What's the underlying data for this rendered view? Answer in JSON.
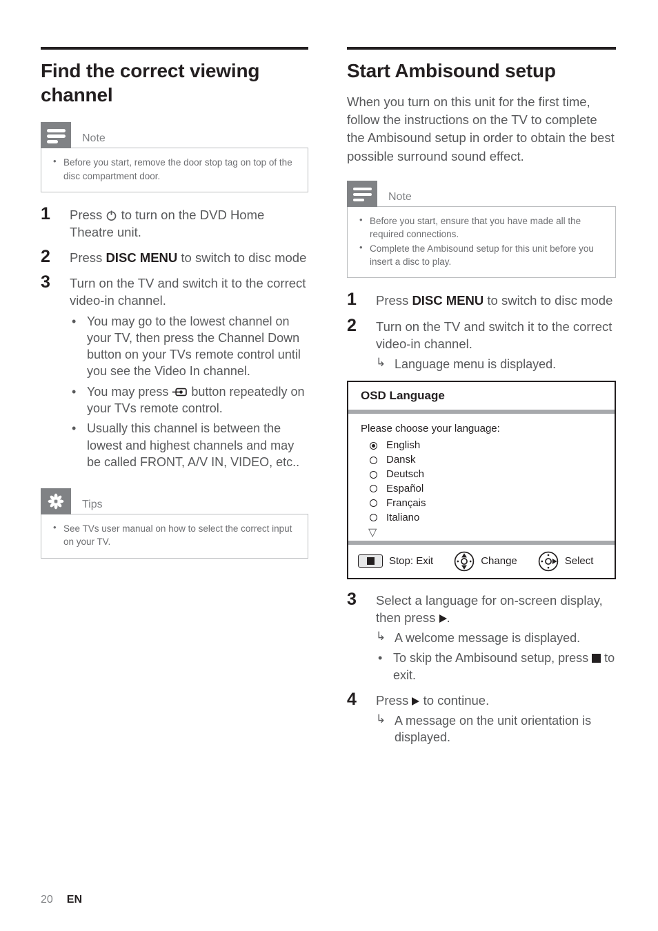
{
  "left": {
    "heading": "Find the correct viewing channel",
    "note": {
      "title": "Note",
      "icon": "note-lines-icon",
      "items": [
        "Before you start, remove the door stop tag on top of the disc compartment door."
      ]
    },
    "steps": [
      {
        "num": "1",
        "pre": "Press ",
        "icon": "power-icon",
        "post": " to turn on the DVD Home Theatre unit."
      },
      {
        "num": "2",
        "pre": "Press ",
        "bold": "DISC MENU",
        "post": " to switch to disc mode"
      },
      {
        "num": "3",
        "text": "Turn on the TV and switch it to the correct video-in channel.",
        "substeps": [
          {
            "marker": "bullet",
            "text": "You may go to the lowest channel on your TV, then press the Channel Down button on your TVs remote control until you see the Video In channel."
          },
          {
            "marker": "bullet",
            "pre": "You may press ",
            "icon": "av-input-icon",
            "post": " button repeatedly on your TVs remote control."
          },
          {
            "marker": "bullet",
            "text": "Usually this channel is between the lowest and highest channels and may be called FRONT, A/V IN, VIDEO, etc.."
          }
        ]
      }
    ],
    "tips": {
      "title": "Tips",
      "icon": "starburst-icon",
      "items": [
        "See TVs user manual on how to select the correct input on your TV."
      ]
    }
  },
  "right": {
    "heading": "Start Ambisound setup",
    "intro": "When you turn on this unit for the first time, follow the instructions on the TV to complete the Ambisound setup in order to obtain the best possible surround sound effect.",
    "note": {
      "title": "Note",
      "icon": "note-lines-icon",
      "items": [
        "Before you start, ensure that you have made all the required connections.",
        "Complete the Ambisound setup for this unit before you insert a disc to play."
      ]
    },
    "steps": [
      {
        "num": "1",
        "pre": "Press ",
        "bold": "DISC MENU",
        "post": " to switch to disc mode"
      },
      {
        "num": "2",
        "text": "Turn on the TV and switch it to the correct video-in channel.",
        "substeps": [
          {
            "marker": "arrow",
            "text": "Language menu is displayed."
          }
        ]
      },
      {
        "num": "3",
        "pre": "Select a language for on-screen display, then press ",
        "icon": "play-right-icon",
        "post": ".",
        "substeps": [
          {
            "marker": "arrow",
            "text": "A welcome message is displayed."
          },
          {
            "marker": "bullet",
            "pre": "To skip the Ambisound setup, press ",
            "icon": "stop-square-icon",
            "post": " to exit."
          }
        ]
      },
      {
        "num": "4",
        "pre": "Press ",
        "icon": "play-right-icon",
        "post": " to continue.",
        "substeps": [
          {
            "marker": "arrow",
            "text": "A message on the unit orientation is displayed."
          }
        ]
      }
    ],
    "osd": {
      "title": "OSD Language",
      "prompt": "Please choose your language:",
      "options": [
        {
          "label": "English",
          "selected": true
        },
        {
          "label": "Dansk",
          "selected": false
        },
        {
          "label": "Deutsch",
          "selected": false
        },
        {
          "label": "Español",
          "selected": false
        },
        {
          "label": "Français",
          "selected": false
        },
        {
          "label": "Italiano",
          "selected": false
        }
      ],
      "more_indicator": "▽",
      "footer": [
        {
          "icon": "stop-button-icon",
          "label": "Stop: Exit"
        },
        {
          "icon": "nav-updown-icon",
          "label": "Change"
        },
        {
          "icon": "nav-right-icon",
          "label": "Select"
        }
      ]
    }
  },
  "footer": {
    "page_number": "20",
    "language_code": "EN"
  },
  "colors": {
    "ink": "#231f20",
    "body_text": "#58595b",
    "callout_badge": "#808285",
    "callout_border": "#bcbec0",
    "osd_separator": "#a7a9ac"
  }
}
